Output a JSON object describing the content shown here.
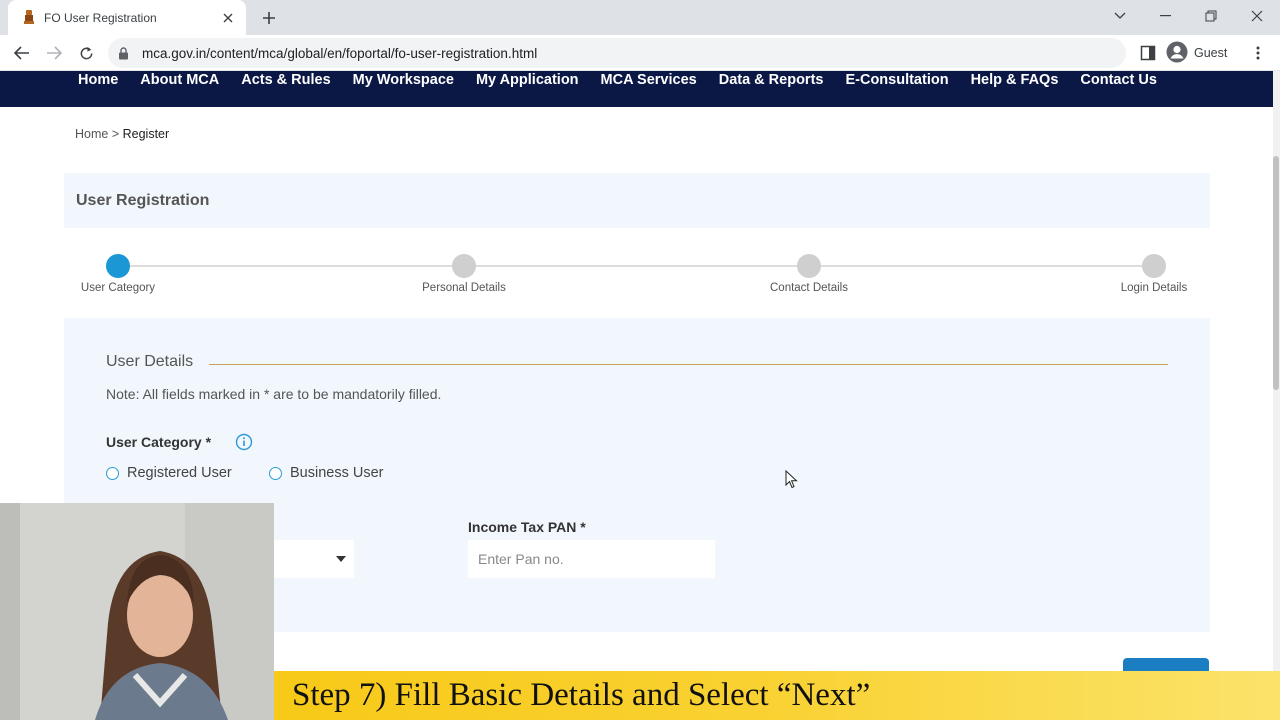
{
  "browser": {
    "tab_title": "FO User Registration",
    "url": "mca.gov.in/content/mca/global/en/foportal/fo-user-registration.html",
    "profile_name": "Guest"
  },
  "nav": {
    "items": [
      "Home",
      "About MCA",
      "Acts & Rules",
      "My Workspace",
      "My Application",
      "MCA Services",
      "Data & Reports",
      "E-Consultation",
      "Help & FAQs",
      "Contact Us"
    ]
  },
  "breadcrumb": {
    "home": "Home",
    "separator": ">",
    "current": "Register"
  },
  "page": {
    "title": "User Registration"
  },
  "stepper": {
    "steps": [
      "User Category",
      "Personal Details",
      "Contact Details",
      "Login Details"
    ],
    "active_step": 0,
    "active_color": "#1b97d5"
  },
  "form": {
    "section_title": "User Details",
    "note": "Note: All fields marked in * are to be mandatorily filled.",
    "user_category": {
      "label": "User Category *",
      "options": [
        "Registered User",
        "Business User"
      ]
    },
    "pan": {
      "label": "Income Tax PAN *",
      "placeholder": "Enter Pan no.",
      "value": ""
    }
  },
  "overlay": {
    "banner_text": "Step 7) Fill Basic Details and Select “Next”",
    "banner_color": "#f7c918"
  },
  "colors": {
    "nav_bg": "#0b1846",
    "panel_bg": "#f1f7fc",
    "accent": "#1b97d5"
  }
}
